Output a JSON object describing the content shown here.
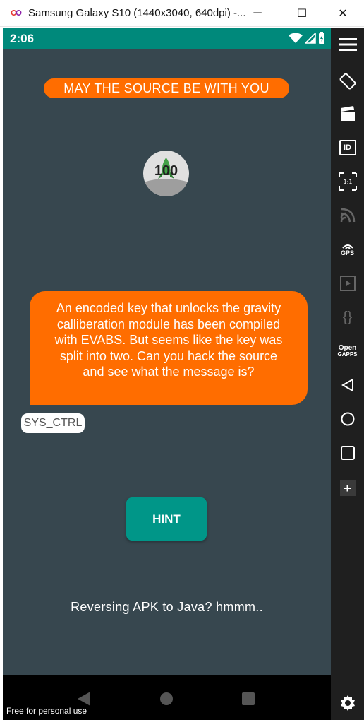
{
  "window": {
    "title": "Samsung Galaxy S10 (1440x3040, 640dpi) -...",
    "minimize_label": "─",
    "maximize_label": "☐",
    "close_label": "✕"
  },
  "status_bar": {
    "time": "2:06"
  },
  "app": {
    "header_pill": "MAY THE SOURCE BE WITH YOU",
    "badge_value": "100",
    "message": "An encoded key that unlocks the gravity calliberation module has been compiled with EVABS. But seems like the key was split into two. Can you hack the source and see what the message is?",
    "sender": "SYS_CTRL",
    "hint_button": "HINT",
    "footer": "Reversing APK to Java? hmmm.."
  },
  "overlay": {
    "watermark": "Free for personal use"
  },
  "toolbar": {
    "items": [
      "menu-icon",
      "rotate-icon",
      "screen-record-icon",
      "device-id-icon",
      "resize-icon",
      "cast-icon",
      "gps-icon",
      "media-icon",
      "code-icon",
      "opengapps-icon",
      "back-icon",
      "home-icon",
      "overview-icon",
      "add-icon",
      "settings-icon"
    ],
    "id_label": "ID",
    "ratio_label": "1:1",
    "gps_label": "GPS",
    "open_label": "Open",
    "gapps_label": "GAPPS"
  },
  "colors": {
    "status_bar": "#00897b",
    "accent_orange": "#ff6d00",
    "hint_button": "#009688",
    "background": "#37474f"
  }
}
